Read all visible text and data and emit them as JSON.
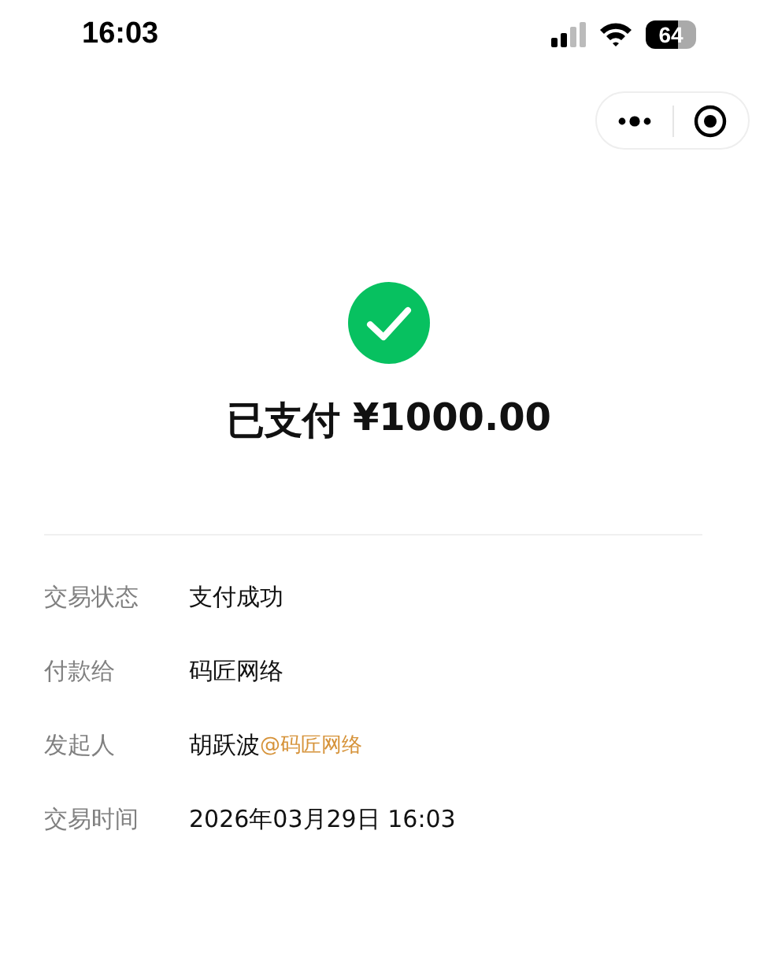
{
  "status_bar": {
    "time": "16:03",
    "battery": "64"
  },
  "payment": {
    "status": "已支付",
    "amount": "¥1000.00"
  },
  "details": [
    {
      "label": "交易状态",
      "value": "支付成功"
    },
    {
      "label": "付款给",
      "value": "码匠网络"
    },
    {
      "label": "发起人",
      "value": "胡跃波",
      "note": "@码匠网络"
    },
    {
      "label": "交易时间",
      "value": "2026年03月29日 16:03"
    }
  ]
}
